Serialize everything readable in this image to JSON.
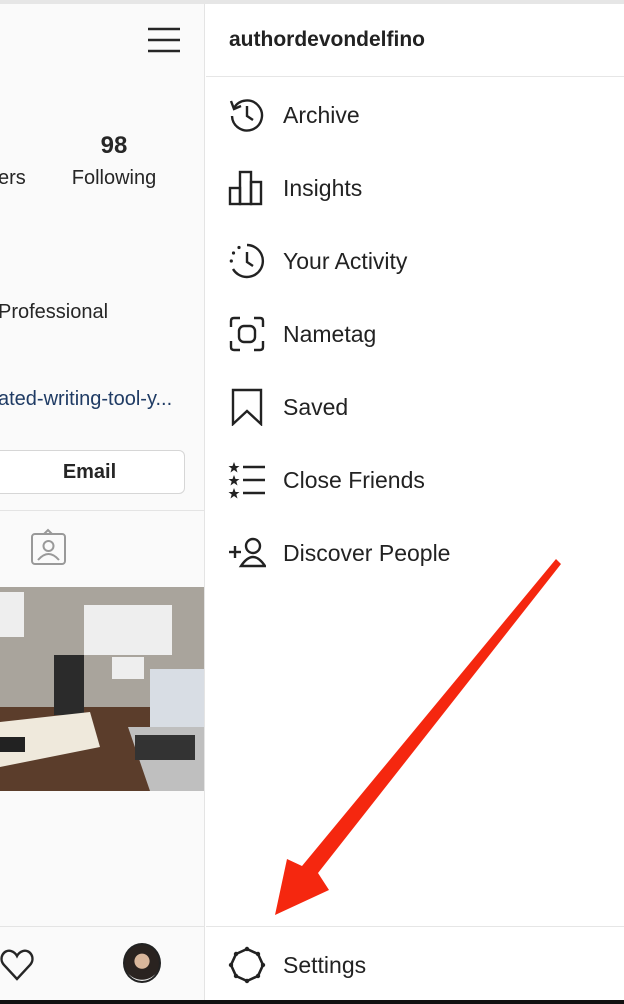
{
  "profile": {
    "followers_label_partial": "ers",
    "following_count": "98",
    "following_label": "Following",
    "category_partial": "Professional",
    "link_partial": "ated-writing-tool-y...",
    "email_button": "Email"
  },
  "menu": {
    "username": "authordevondelfino",
    "items": [
      {
        "label": "Archive",
        "icon": "archive-icon"
      },
      {
        "label": "Insights",
        "icon": "insights-icon"
      },
      {
        "label": "Your Activity",
        "icon": "activity-icon"
      },
      {
        "label": "Nametag",
        "icon": "nametag-icon"
      },
      {
        "label": "Saved",
        "icon": "bookmark-icon"
      },
      {
        "label": "Close Friends",
        "icon": "close-friends-icon"
      },
      {
        "label": "Discover People",
        "icon": "add-person-icon"
      }
    ],
    "settings_label": "Settings"
  },
  "colors": {
    "arrow": "#f5270f",
    "link": "#1f3b64"
  }
}
